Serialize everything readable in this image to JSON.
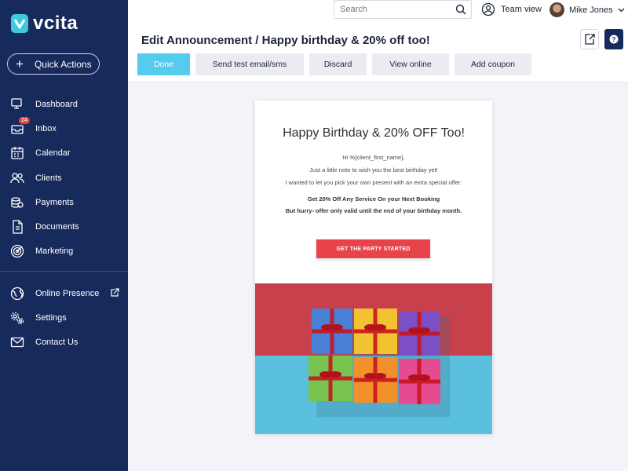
{
  "app": {
    "logo_text": "vcita"
  },
  "sidebar": {
    "quick_actions_label": "Quick Actions",
    "items": [
      {
        "label": "Dashboard",
        "icon": "dashboard-icon"
      },
      {
        "label": "Inbox",
        "icon": "inbox-icon",
        "badge": "24"
      },
      {
        "label": "Calendar",
        "icon": "calendar-icon"
      },
      {
        "label": "Clients",
        "icon": "clients-icon"
      },
      {
        "label": "Payments",
        "icon": "payments-icon"
      },
      {
        "label": "Documents",
        "icon": "documents-icon"
      },
      {
        "label": "Marketing",
        "icon": "marketing-icon"
      }
    ],
    "secondary_items": [
      {
        "label": "Online Presence",
        "icon": "globe-icon",
        "external": true
      },
      {
        "label": "Settings",
        "icon": "settings-icon"
      },
      {
        "label": "Contact Us",
        "icon": "mail-icon"
      }
    ]
  },
  "topbar": {
    "search_placeholder": "Search",
    "team_view_label": "Team view",
    "user_name": "Mike Jones"
  },
  "editor": {
    "title": "Edit Announcement / Happy birthday & 20% off too!",
    "buttons": {
      "done": "Done",
      "send_test": "Send test email/sms",
      "discard": "Discard",
      "view_online": "View online",
      "add_coupon": "Add coupon"
    }
  },
  "email": {
    "heading": "Happy Birthday & 20% OFF Too!",
    "greeting": "Hi %{client_first_name},",
    "line1": "Just a little note to wish you the best birthday yet!",
    "line2": "I wanted to let you pick your own present with an extra special offer:",
    "offer": "Get 20% Off Any Service On your Next Booking",
    "deadline": "But hurry- offer only valid until the end of your birthday month.",
    "cta_label": "GET THE PARTY STARTED"
  },
  "colors": {
    "sidebar": "#162a5c",
    "accent": "#56ccec",
    "cta": "#e8424b",
    "badge": "#e8453c"
  }
}
